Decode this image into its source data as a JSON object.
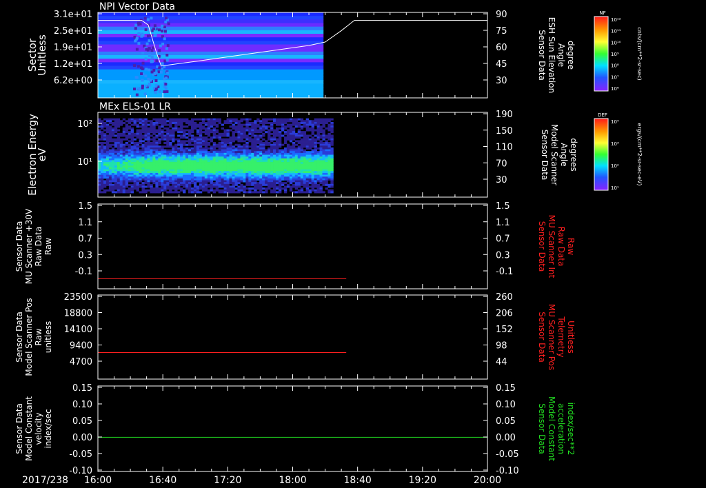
{
  "date_label": "2017/238",
  "time_axis": {
    "ticks": [
      "16:00",
      "16:40",
      "17:20",
      "18:00",
      "18:40",
      "19:20",
      "20:00"
    ]
  },
  "panels": [
    {
      "title": "NPI Vector Data",
      "ylabel": [
        "Sector",
        "Unitless"
      ],
      "yticks_left": [
        "3.1e+01",
        "2.5e+01",
        "1.9e+01",
        "1.2e+01",
        "6.2e+00"
      ],
      "ylabel_right": [
        "Sensor Data",
        "ESH Sun Elevation",
        "Angle",
        "degree"
      ],
      "yticks_right": [
        "90",
        "75",
        "60",
        "45",
        "30"
      ],
      "right_color": "#ffffff",
      "colorbar": {
        "label": "NF",
        "units": "cnts/(cm**2-sr-sec)",
        "ticks": [
          "10¹²",
          "10¹¹",
          "10¹⁰",
          "10⁹",
          "10⁸",
          "10⁷",
          "10⁶"
        ]
      }
    },
    {
      "title": "MEx ELS-01 LR",
      "ylabel": [
        "Electron Energy",
        "eV"
      ],
      "yticks_left": [
        "10²",
        "10¹"
      ],
      "ylabel_right": [
        "Sensor Data",
        "Model Scanner",
        "Angle",
        "degrees"
      ],
      "yticks_right": [
        "190",
        "150",
        "110",
        "70",
        "30"
      ],
      "right_color": "#ffffff",
      "colorbar": {
        "label": "DEF",
        "units": "ergs/(cm**2-sr-sec-eV)",
        "ticks": [
          "10⁴",
          "10³",
          "10²",
          "10¹"
        ]
      }
    },
    {
      "title": "",
      "ylabel": [
        "Sensor Data",
        "MU Scanner +30V",
        "Raw Data",
        "Raw"
      ],
      "yticks_left": [
        "1.5",
        "1.1",
        "0.7",
        "0.3",
        "-0.1"
      ],
      "ylabel_right": [
        "Sensor Data",
        "MU Scanner Int",
        "Raw Data",
        "Raw"
      ],
      "yticks_right": [
        "1.5",
        "1.1",
        "0.7",
        "0.3",
        "-0.1"
      ],
      "right_color": "#ff2020"
    },
    {
      "title": "",
      "ylabel": [
        "Sensor Data",
        "Model Scanner Pos",
        "Raw",
        "unitless"
      ],
      "yticks_left": [
        "23500",
        "18800",
        "14100",
        "9400",
        "4700"
      ],
      "ylabel_right": [
        "Sensor Data",
        "MU Scanner Pos",
        "Telemetry",
        "Unitless"
      ],
      "yticks_right": [
        "260",
        "206",
        "152",
        "98",
        "44"
      ],
      "right_color": "#ff2020"
    },
    {
      "title": "",
      "ylabel": [
        "Sensor Data",
        "Model Constant",
        "velocity",
        "index/sec"
      ],
      "yticks_left": [
        "0.15",
        "0.10",
        "0.05",
        "0.00",
        "-0.05",
        "-0.10"
      ],
      "ylabel_right": [
        "Sensor Data",
        "Model Constant",
        "acceleration",
        "index/sec**2"
      ],
      "yticks_right": [
        "0.15",
        "0.10",
        "0.05",
        "0.00",
        "-0.05",
        "-0.10"
      ],
      "right_color": "#22e022"
    }
  ],
  "chart_data": [
    {
      "type": "heatmap",
      "title": "NPI Vector Data",
      "xlabel": "",
      "ylabel": "Sector Unitless",
      "x_range": [
        "16:00",
        "20:00"
      ],
      "data_extent": [
        "16:00",
        "18:19"
      ],
      "overlay_line": {
        "name": "Sensor Data ESH Sun Elevation Angle",
        "y_range": [
          15,
          90
        ],
        "points": [
          [
            "16:00",
            83
          ],
          [
            "16:27",
            83
          ],
          [
            "16:31",
            79
          ],
          [
            "16:36",
            55
          ],
          [
            "16:39",
            43
          ],
          [
            "17:00",
            47
          ],
          [
            "17:40",
            55
          ],
          [
            "18:10",
            61
          ],
          [
            "18:20",
            64
          ],
          [
            "18:30",
            74
          ],
          [
            "18:38",
            83
          ],
          [
            "20:00",
            83
          ]
        ]
      }
    },
    {
      "type": "heatmap",
      "title": "MEx ELS-01 LR",
      "ylabel": "Electron Energy eV",
      "yscale": "log",
      "x_range": [
        "16:00",
        "20:00"
      ],
      "data_extent": [
        "16:00",
        "18:25"
      ],
      "overlay_line": {
        "name": "Sensor Data Model Scanner Angle",
        "y_range": [
          0,
          190
        ],
        "points": [
          [
            "16:00",
            0
          ],
          [
            "20:00",
            0
          ]
        ]
      }
    },
    {
      "type": "line",
      "series": [
        {
          "name": "Sensor Data MU Scanner Int Raw Data",
          "color": "#ff2020",
          "x": [
            "16:00",
            "18:33"
          ],
          "y": [
            0.0,
            0.0
          ]
        }
      ],
      "ylim": [
        -0.2,
        1.5
      ]
    },
    {
      "type": "line",
      "series": [
        {
          "name": "Sensor Data MU Scanner Pos Telemetry",
          "color": "#ff2020",
          "x": [
            "16:00",
            "18:33"
          ],
          "y": [
            8100,
            8100
          ]
        }
      ],
      "ylim": [
        1000,
        23500
      ]
    },
    {
      "type": "line",
      "series": [
        {
          "name": "Sensor Data Model Constant acceleration",
          "color": "#22e022",
          "x": [
            "16:00",
            "20:00"
          ],
          "y": [
            0.0,
            0.0
          ]
        }
      ],
      "ylim": [
        -0.1,
        0.15
      ]
    }
  ]
}
